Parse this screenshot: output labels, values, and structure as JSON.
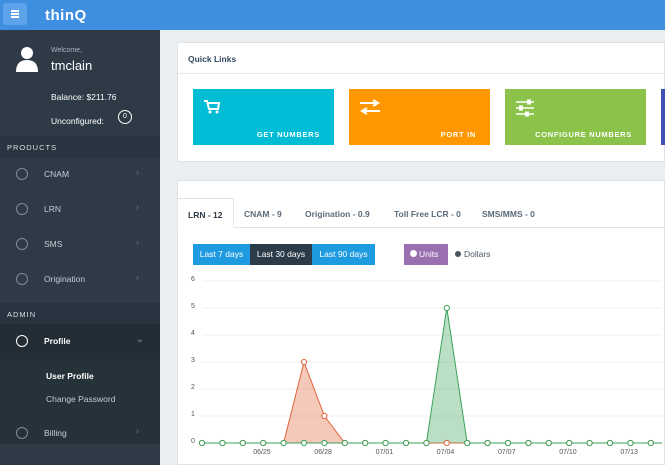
{
  "app": {
    "logo": "thinQ"
  },
  "user": {
    "welcome": "Welcome,",
    "name": "tmclain",
    "balance": "Balance: $211.76",
    "unconfigured_label": "Unconfigured:",
    "unconfigured_count": "0"
  },
  "sidebar": {
    "products_heading": "PRODUCTS",
    "admin_heading": "ADMIN",
    "items": [
      {
        "label": "CNAM"
      },
      {
        "label": "LRN"
      },
      {
        "label": "SMS"
      },
      {
        "label": "Origination"
      }
    ],
    "profile": {
      "label": "Profile"
    },
    "sub_items": [
      {
        "label": "User Profile"
      },
      {
        "label": "Change Password"
      }
    ],
    "billing": {
      "label": "Billing"
    }
  },
  "quick_links": {
    "title": "Quick Links",
    "cards": [
      {
        "label": "GET NUMBERS",
        "color": "#00bcd4"
      },
      {
        "label": "PORT IN",
        "color": "#ff9800"
      },
      {
        "label": "CONFIGURE NUMBERS",
        "color": "#8bc34a"
      }
    ]
  },
  "tabs": [
    {
      "label": "LRN - 12"
    },
    {
      "label": "CNAM - 9"
    },
    {
      "label": "Origination - 0.9"
    },
    {
      "label": "Toll Free LCR - 0"
    },
    {
      "label": "SMS/MMS - 0"
    }
  ],
  "range_buttons": [
    {
      "label": "Last 7 days"
    },
    {
      "label": "Last 30 days"
    },
    {
      "label": "Last 90 days"
    }
  ],
  "toggles": {
    "units": "Units",
    "dollars": "Dollars"
  },
  "chart_data": {
    "type": "area",
    "ylim": [
      0,
      6
    ],
    "yticks": [
      "6",
      "5",
      "4",
      "3",
      "2",
      "1",
      "0"
    ],
    "x_labels": [
      "06/25",
      "06/28",
      "07/01",
      "07/04",
      "07/07",
      "07/10",
      "07/13"
    ],
    "series": [
      {
        "color": "#e0643a",
        "values": [
          0,
          0,
          0,
          0,
          0,
          3,
          1,
          0,
          0,
          0,
          0,
          0,
          0,
          0,
          0,
          0,
          0,
          0,
          0,
          0,
          0,
          0,
          0,
          0,
          0,
          0,
          0,
          0,
          0,
          0,
          0,
          0,
          0,
          0,
          0,
          0,
          0,
          0,
          0,
          0,
          0,
          0,
          0,
          0,
          0,
          0
        ]
      },
      {
        "color": "#3aa35a",
        "values": [
          0,
          0,
          0,
          0,
          0,
          0,
          0,
          0,
          0,
          0,
          0,
          0,
          5,
          0,
          0,
          0,
          0,
          0,
          0,
          0,
          0,
          0,
          0,
          0,
          0,
          0,
          0,
          0,
          0,
          0,
          0,
          0,
          0,
          0,
          0,
          0,
          0,
          0,
          0,
          0,
          0,
          0,
          0,
          0,
          0,
          0
        ]
      }
    ]
  }
}
